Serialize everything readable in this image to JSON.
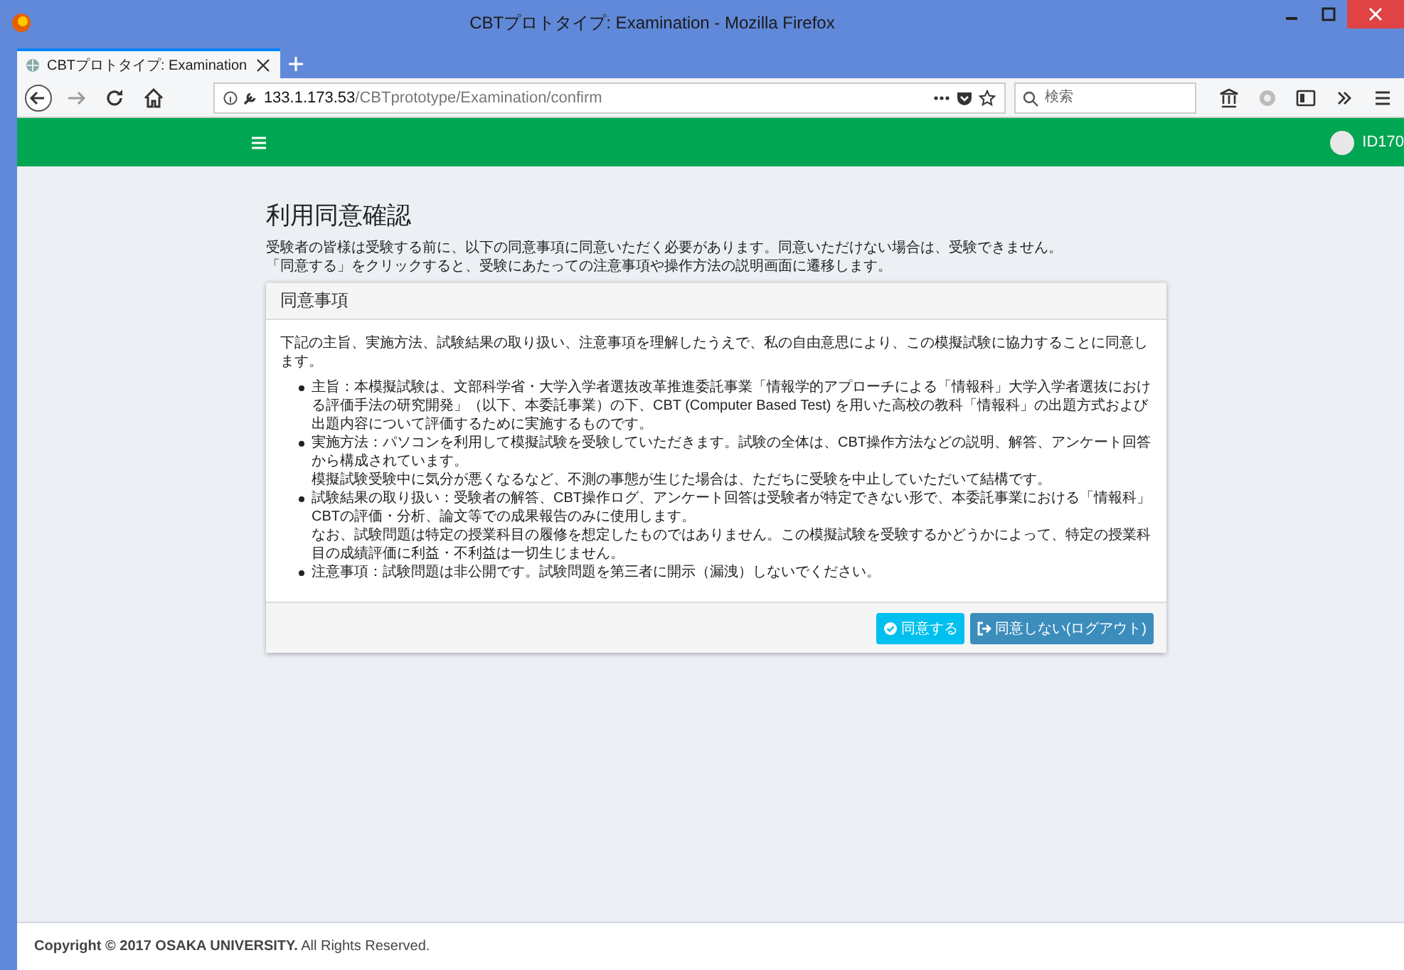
{
  "window": {
    "title": "CBTプロトタイプ: Examination - Mozilla Firefox"
  },
  "tabs": [
    {
      "label": "CBTプロトタイプ: Examination",
      "selected": true
    }
  ],
  "address_bar": {
    "host": "133.1.173.53",
    "path": "/CBTprototype/Examination/confirm"
  },
  "search": {
    "placeholder": "検索"
  },
  "app_bar": {
    "user": "ID170"
  },
  "page": {
    "title": "利用同意確認",
    "intro": [
      "受験者の皆様は受験する前に、以下の同意事項に同意いただく必要があります。同意いただけない場合は、受験できません。",
      "「同意する」をクリックすると、受験にあたっての注意事項や操作方法の説明画面に遷移します。"
    ],
    "card": {
      "title": "同意事項",
      "lead": "下記の主旨、実施方法、試験結果の取り扱い、注意事項を理解したうえで、私の自由意思により、この模擬試験に協力することに同意します。",
      "items": [
        {
          "lines": [
            "主旨：本模擬試験は、文部科学省・大学入学者選抜改革推進委託事業「情報学的アプローチによる「情報科」大学入学者選抜における評価手法の研究開発」（以下、本委託事業）の下、CBT (Computer Based Test) を用いた高校の教科「情報科」の出題方式および出題内容について評価するために実施するものです。"
          ]
        },
        {
          "lines": [
            "実施方法：パソコンを利用して模擬試験を受験していただきます。試験の全体は、CBT操作方法などの説明、解答、アンケート回答から構成されています。",
            "模擬試験受験中に気分が悪くなるなど、不測の事態が生じた場合は、ただちに受験を中止していただいて結構です。"
          ]
        },
        {
          "lines": [
            "試験結果の取り扱い：受験者の解答、CBT操作ログ、アンケート回答は受験者が特定できない形で、本委託事業における「情報科」CBTの評価・分析、論文等での成果報告のみに使用します。",
            "なお、試験問題は特定の授業科目の履修を想定したものではありません。この模擬試験を受験するかどうかによって、特定の授業科目の成績評価に利益・不利益は一切生じません。"
          ]
        },
        {
          "lines": [
            "注意事項：試験問題は非公開です。試験問題を第三者に開示（漏洩）しないでください。"
          ]
        }
      ],
      "buttons": [
        {
          "label": "同意する",
          "kind": "agree"
        },
        {
          "label": "同意しない(ログアウト)",
          "kind": "logout"
        }
      ]
    }
  },
  "footer": "**Copyright © 2017 OSAKA UNIVERSITY.** All Rights Reserved."
}
